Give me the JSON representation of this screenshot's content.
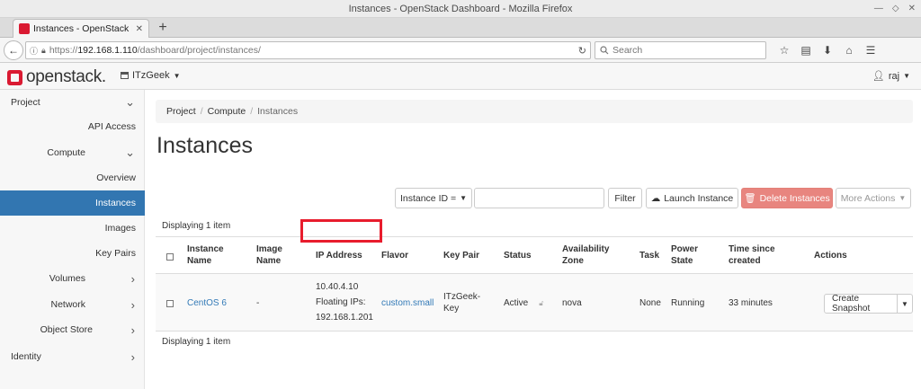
{
  "window": {
    "title": "Instances - OpenStack Dashboard - Mozilla Firefox"
  },
  "browser": {
    "tab_title": "Instances - OpenStack Dasl",
    "url_scheme": "https://",
    "url_host": "192.168.1.110",
    "url_path": "/dashboard/project/instances/",
    "search_placeholder": "Search"
  },
  "header": {
    "logo_text": "openstack.",
    "project": "ITzGeek",
    "user": "raj"
  },
  "sidebar": {
    "items": [
      {
        "label": "Project"
      },
      {
        "label": "API Access"
      },
      {
        "label": "Compute"
      },
      {
        "label": "Overview"
      },
      {
        "label": "Instances"
      },
      {
        "label": "Images"
      },
      {
        "label": "Key Pairs"
      },
      {
        "label": "Volumes"
      },
      {
        "label": "Network"
      },
      {
        "label": "Object Store"
      },
      {
        "label": "Identity"
      }
    ]
  },
  "breadcrumb": {
    "project": "Project",
    "compute": "Compute",
    "current": "Instances"
  },
  "page_title": "Instances",
  "toolbar": {
    "filter_field": "Instance ID =",
    "filter_button": "Filter",
    "launch_button": "Launch Instance",
    "delete_button": "Delete Instances",
    "more_button": "More Actions"
  },
  "displaying_text": "Displaying 1 item",
  "table": {
    "headers": {
      "name_1": "Instance",
      "name_2": "Name",
      "image_1": "Image",
      "image_2": "Name",
      "ip": "IP Address",
      "flavor": "Flavor",
      "keypair": "Key Pair",
      "status": "Status",
      "az_1": "Availability",
      "az_2": "Zone",
      "task": "Task",
      "power_1": "Power",
      "power_2": "State",
      "time_1": "Time since",
      "time_2": "created",
      "actions": "Actions"
    },
    "row": {
      "name": "CentOS 6",
      "image": "-",
      "ip_fixed": "10.40.4.10",
      "ip_floating_label": "Floating IPs:",
      "ip_floating": "192.168.1.201",
      "flavor": "custom.small",
      "keypair_1": "ITzGeek-",
      "keypair_2": "Key",
      "status": "Active",
      "az": "nova",
      "task": "None",
      "power": "Running",
      "time": "33 minutes",
      "action": "Create Snapshot"
    }
  },
  "colors": {
    "accent": "#3276b1",
    "link": "#337ab7",
    "brand": "#da1a32",
    "danger": "#e8857f",
    "highlight": "#e81c2d"
  }
}
